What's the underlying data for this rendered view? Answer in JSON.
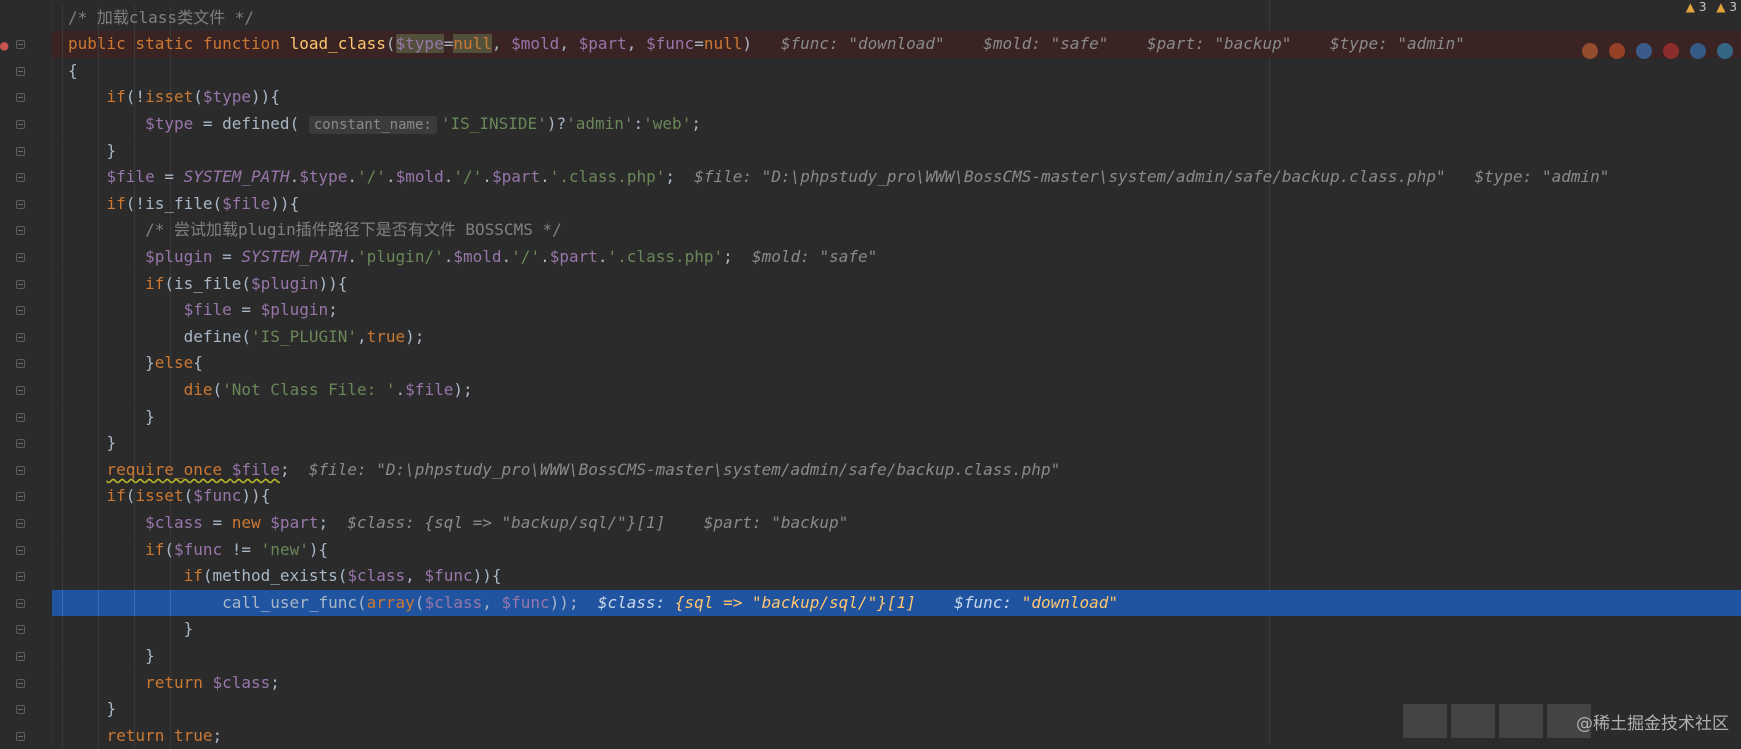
{
  "editor": {
    "lines": [
      [
        [
          "cmt",
          "/* 加载class类文件 */"
        ]
      ],
      [
        [
          "kw",
          "public static function "
        ],
        [
          "fn",
          "load_class"
        ],
        [
          "txt",
          "("
        ],
        [
          "varhl",
          "$type"
        ],
        [
          "txt",
          "="
        ],
        [
          "kwhl",
          "null"
        ],
        [
          "txt",
          ", "
        ],
        [
          "var",
          "$mold"
        ],
        [
          "txt",
          ", "
        ],
        [
          "var",
          "$part"
        ],
        [
          "txt",
          ", "
        ],
        [
          "var",
          "$func"
        ],
        [
          "txt",
          "="
        ],
        [
          "kw",
          "null"
        ],
        [
          "txt",
          ")"
        ],
        [
          "inl",
          "   $func: \"download\"    $mold: \"safe\"    $part: \"backup\"    $type: \"admin\""
        ]
      ],
      [
        [
          "txt",
          "{"
        ]
      ],
      [
        [
          "txt",
          "    "
        ],
        [
          "kw",
          "if"
        ],
        [
          "txt",
          "(!"
        ],
        [
          "kw",
          "isset"
        ],
        [
          "txt",
          "("
        ],
        [
          "var",
          "$type"
        ],
        [
          "txt",
          "))"
        ],
        [
          "txt",
          "{"
        ]
      ],
      [
        [
          "txt",
          "        "
        ],
        [
          "var",
          "$type"
        ],
        [
          "txt",
          " = defined( "
        ],
        [
          "hint",
          "constant_name:"
        ],
        [
          "str",
          "'IS_INSIDE'"
        ],
        [
          "txt",
          ")?"
        ],
        [
          "str",
          "'admin'"
        ],
        [
          "txt",
          ":"
        ],
        [
          "str",
          "'web'"
        ],
        [
          "txt",
          ";"
        ]
      ],
      [
        [
          "txt",
          "    }"
        ]
      ],
      [
        [
          "txt",
          "    "
        ],
        [
          "var",
          "$file"
        ],
        [
          "txt",
          " = "
        ],
        [
          "cnst",
          "SYSTEM_PATH"
        ],
        [
          "txt",
          "."
        ],
        [
          "var",
          "$type"
        ],
        [
          "txt",
          "."
        ],
        [
          "str",
          "'/'"
        ],
        [
          "txt",
          "."
        ],
        [
          "var",
          "$mold"
        ],
        [
          "txt",
          "."
        ],
        [
          "str",
          "'/'"
        ],
        [
          "txt",
          "."
        ],
        [
          "var",
          "$part"
        ],
        [
          "txt",
          "."
        ],
        [
          "str",
          "'.class.php'"
        ],
        [
          "txt",
          ";"
        ],
        [
          "inl",
          "  $file: \"D:\\phpstudy_pro\\WWW\\BossCMS-master\\system/admin/safe/backup.class.php\"   $type: \"admin\""
        ]
      ],
      [
        [
          "txt",
          "    "
        ],
        [
          "kw",
          "if"
        ],
        [
          "txt",
          "(!is_file("
        ],
        [
          "var",
          "$file"
        ],
        [
          "txt",
          "))"
        ],
        [
          "txt",
          "{"
        ]
      ],
      [
        [
          "txt",
          "        "
        ],
        [
          "cmt",
          "/* 尝试加载plugin插件路径下是否有文件 BOSSCMS */"
        ]
      ],
      [
        [
          "txt",
          "        "
        ],
        [
          "var",
          "$plugin"
        ],
        [
          "txt",
          " = "
        ],
        [
          "cnst",
          "SYSTEM_PATH"
        ],
        [
          "txt",
          "."
        ],
        [
          "str",
          "'plugin/'"
        ],
        [
          "txt",
          "."
        ],
        [
          "var",
          "$mold"
        ],
        [
          "txt",
          "."
        ],
        [
          "str",
          "'/'"
        ],
        [
          "txt",
          "."
        ],
        [
          "var",
          "$part"
        ],
        [
          "txt",
          "."
        ],
        [
          "str",
          "'.class.php'"
        ],
        [
          "txt",
          ";"
        ],
        [
          "inl",
          "  $mold: \"safe\""
        ]
      ],
      [
        [
          "txt",
          "        "
        ],
        [
          "kw",
          "if"
        ],
        [
          "txt",
          "(is_file("
        ],
        [
          "var",
          "$plugin"
        ],
        [
          "txt",
          "))"
        ],
        [
          "txt",
          "{"
        ]
      ],
      [
        [
          "txt",
          "            "
        ],
        [
          "var",
          "$file"
        ],
        [
          "txt",
          " = "
        ],
        [
          "var",
          "$plugin"
        ],
        [
          "txt",
          ";"
        ]
      ],
      [
        [
          "txt",
          "            define("
        ],
        [
          "str",
          "'IS_PLUGIN'"
        ],
        [
          "txt",
          ","
        ],
        [
          "kw",
          "true"
        ],
        [
          "txt",
          ");"
        ]
      ],
      [
        [
          "txt",
          "        }"
        ],
        [
          "kw",
          "else"
        ],
        [
          "txt",
          "{"
        ]
      ],
      [
        [
          "txt",
          "            "
        ],
        [
          "kw",
          "die"
        ],
        [
          "txt",
          "("
        ],
        [
          "str",
          "'Not Class File: '"
        ],
        [
          "txt",
          "."
        ],
        [
          "var",
          "$file"
        ],
        [
          "txt",
          ");"
        ]
      ],
      [
        [
          "txt",
          "        }"
        ]
      ],
      [
        [
          "txt",
          "    }"
        ]
      ],
      [
        [
          "txt",
          "    "
        ],
        [
          "sq",
          "require_once "
        ],
        [
          "sqv",
          "$file"
        ],
        [
          "txt",
          ";"
        ],
        [
          "inl",
          "  $file: \"D:\\phpstudy_pro\\WWW\\BossCMS-master\\system/admin/safe/backup.class.php\""
        ]
      ],
      [
        [
          "txt",
          "    "
        ],
        [
          "kw",
          "if"
        ],
        [
          "txt",
          "("
        ],
        [
          "kw",
          "isset"
        ],
        [
          "txt",
          "("
        ],
        [
          "var",
          "$func"
        ],
        [
          "txt",
          "))"
        ],
        [
          "txt",
          "{"
        ]
      ],
      [
        [
          "txt",
          "        "
        ],
        [
          "var",
          "$class"
        ],
        [
          "txt",
          " = "
        ],
        [
          "kw",
          "new "
        ],
        [
          "var",
          "$part"
        ],
        [
          "txt",
          ";"
        ],
        [
          "inl",
          "  $class: {sql => \"backup/sql/\"}[1]    $part: \"backup\""
        ]
      ],
      [
        [
          "txt",
          "        "
        ],
        [
          "kw",
          "if"
        ],
        [
          "txt",
          "("
        ],
        [
          "var",
          "$func"
        ],
        [
          "txt",
          " != "
        ],
        [
          "str",
          "'new'"
        ],
        [
          "txt",
          "){"
        ]
      ],
      [
        [
          "txt",
          "            "
        ],
        [
          "kw",
          "if"
        ],
        [
          "txt",
          "(method_exists("
        ],
        [
          "var",
          "$class"
        ],
        [
          "txt",
          ", "
        ],
        [
          "var",
          "$func"
        ],
        [
          "txt",
          "))"
        ],
        [
          "txt",
          "{"
        ]
      ],
      [
        [
          "txt",
          "                call_user_func("
        ],
        [
          "kw",
          "array"
        ],
        [
          "txt",
          "("
        ],
        [
          "var",
          "$class"
        ],
        [
          "txt",
          ", "
        ],
        [
          "var",
          "$func"
        ],
        [
          "txt",
          "));"
        ],
        [
          "inl",
          "  $class: "
        ],
        [
          "hlv",
          "{sql => \"backup/sql/\"}[1]"
        ],
        [
          "inl",
          "    $func: "
        ],
        [
          "hlv",
          "\"download\""
        ]
      ],
      [
        [
          "txt",
          "            }"
        ]
      ],
      [
        [
          "txt",
          "        }"
        ]
      ],
      [
        [
          "txt",
          "        "
        ],
        [
          "kw",
          "return "
        ],
        [
          "var",
          "$class"
        ],
        [
          "txt",
          ";"
        ]
      ],
      [
        [
          "txt",
          "    }"
        ]
      ],
      [
        [
          "txt",
          "    "
        ],
        [
          "kw",
          "return true"
        ],
        [
          "txt",
          ";"
        ]
      ]
    ],
    "breakpoint_line": 1,
    "current_line": 22
  },
  "status": {
    "warnings_a": "3",
    "warnings_b": "3"
  },
  "watermark": "@稀土掘金技术社区",
  "colors": {
    "background": "#2b2b2b",
    "current_line": "#2154a0",
    "breakpoint_line": "#3a2323",
    "keyword": "#cc7832",
    "function": "#ffc66d",
    "variable": "#9876aa",
    "string": "#6a8759",
    "comment": "#808080"
  }
}
